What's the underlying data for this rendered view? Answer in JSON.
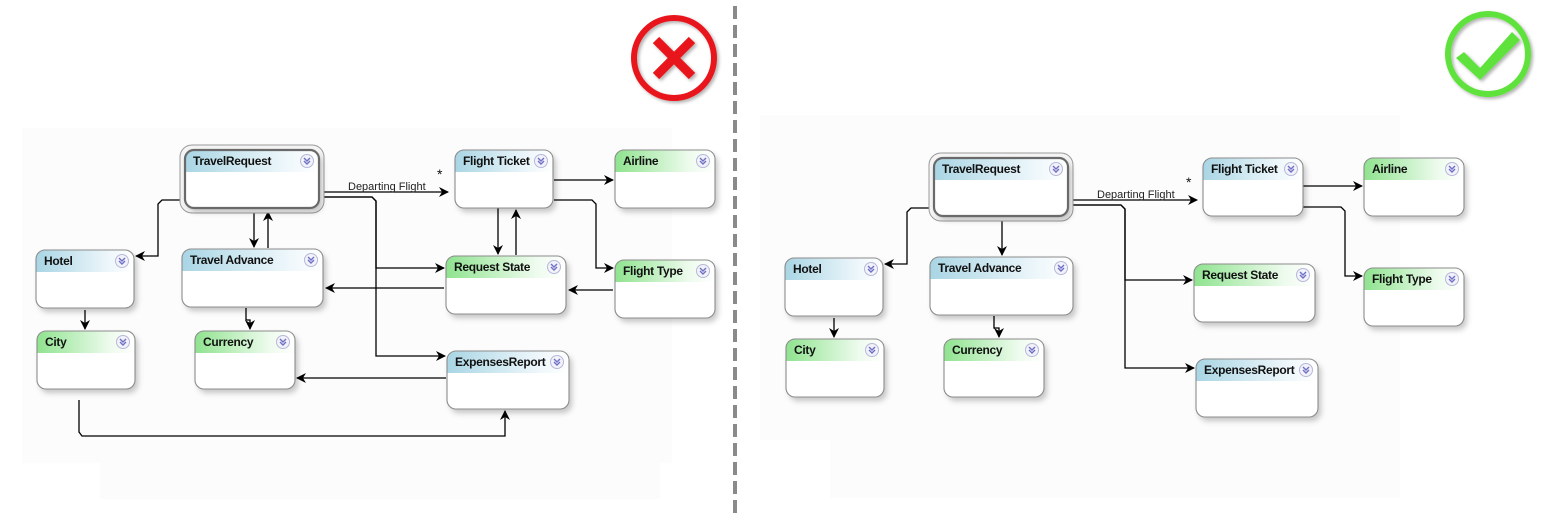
{
  "colors": {
    "entity_header": "#a9d5e4",
    "lookup_header": "#8fe38f",
    "wrong_badge": "#e8141a",
    "correct_badge": "#5ee23a",
    "connector": "#000000",
    "divider": "#8a8a8a"
  },
  "panels": [
    {
      "id": "wrong",
      "verdict": "incorrect",
      "verdict_icon": "x-circle-icon",
      "nodes": [
        {
          "id": "TravelRequest",
          "label": "TravelRequest",
          "kind": "entity",
          "selected": true
        },
        {
          "id": "FlightTicket",
          "label": "Flight Ticket",
          "kind": "entity"
        },
        {
          "id": "Airline",
          "label": "Airline",
          "kind": "lookup"
        },
        {
          "id": "Hotel",
          "label": "Hotel",
          "kind": "entity"
        },
        {
          "id": "TravelAdvance",
          "label": "Travel Advance",
          "kind": "entity"
        },
        {
          "id": "RequestState",
          "label": "Request State",
          "kind": "lookup"
        },
        {
          "id": "FlightType",
          "label": "Flight Type",
          "kind": "lookup"
        },
        {
          "id": "City",
          "label": "City",
          "kind": "lookup"
        },
        {
          "id": "Currency",
          "label": "Currency",
          "kind": "lookup"
        },
        {
          "id": "ExpensesReport",
          "label": "ExpensesReport",
          "kind": "entity"
        }
      ],
      "edges": [
        {
          "from": "TravelRequest",
          "to": "FlightTicket",
          "label": "Departing Flight",
          "multiplicity": "*"
        },
        {
          "from": "TravelRequest",
          "to": "Hotel"
        },
        {
          "from": "TravelRequest",
          "to": "TravelAdvance"
        },
        {
          "from": "TravelAdvance",
          "to": "TravelRequest"
        },
        {
          "from": "TravelRequest",
          "to": "RequestState"
        },
        {
          "from": "TravelRequest",
          "to": "ExpensesReport"
        },
        {
          "from": "FlightTicket",
          "to": "Airline"
        },
        {
          "from": "FlightTicket",
          "to": "FlightType"
        },
        {
          "from": "FlightTicket",
          "to": "RequestState"
        },
        {
          "from": "RequestState",
          "to": "FlightTicket"
        },
        {
          "from": "RequestState",
          "to": "TravelAdvance"
        },
        {
          "from": "FlightType",
          "to": "RequestState"
        },
        {
          "from": "Hotel",
          "to": "City"
        },
        {
          "from": "TravelAdvance",
          "to": "Currency"
        },
        {
          "from": "ExpensesReport",
          "to": "Currency"
        },
        {
          "from": "City",
          "to": "ExpensesReport"
        }
      ]
    },
    {
      "id": "right",
      "verdict": "correct",
      "verdict_icon": "check-circle-icon",
      "nodes": [
        {
          "id": "TravelRequest",
          "label": "TravelRequest",
          "kind": "entity",
          "selected": true
        },
        {
          "id": "FlightTicket",
          "label": "Flight Ticket",
          "kind": "entity"
        },
        {
          "id": "Airline",
          "label": "Airline",
          "kind": "lookup"
        },
        {
          "id": "Hotel",
          "label": "Hotel",
          "kind": "entity"
        },
        {
          "id": "TravelAdvance",
          "label": "Travel Advance",
          "kind": "entity"
        },
        {
          "id": "RequestState",
          "label": "Request State",
          "kind": "lookup"
        },
        {
          "id": "FlightType",
          "label": "Flight Type",
          "kind": "lookup"
        },
        {
          "id": "City",
          "label": "City",
          "kind": "lookup"
        },
        {
          "id": "Currency",
          "label": "Currency",
          "kind": "lookup"
        },
        {
          "id": "ExpensesReport",
          "label": "ExpensesReport",
          "kind": "entity"
        }
      ],
      "edges": [
        {
          "from": "TravelRequest",
          "to": "FlightTicket",
          "label": "Departing Flight",
          "multiplicity": "*"
        },
        {
          "from": "TravelRequest",
          "to": "Hotel"
        },
        {
          "from": "TravelRequest",
          "to": "TravelAdvance"
        },
        {
          "from": "TravelRequest",
          "to": "RequestState"
        },
        {
          "from": "TravelRequest",
          "to": "ExpensesReport"
        },
        {
          "from": "FlightTicket",
          "to": "Airline"
        },
        {
          "from": "FlightTicket",
          "to": "FlightType"
        },
        {
          "from": "Hotel",
          "to": "City"
        },
        {
          "from": "TravelAdvance",
          "to": "Currency"
        }
      ]
    }
  ]
}
